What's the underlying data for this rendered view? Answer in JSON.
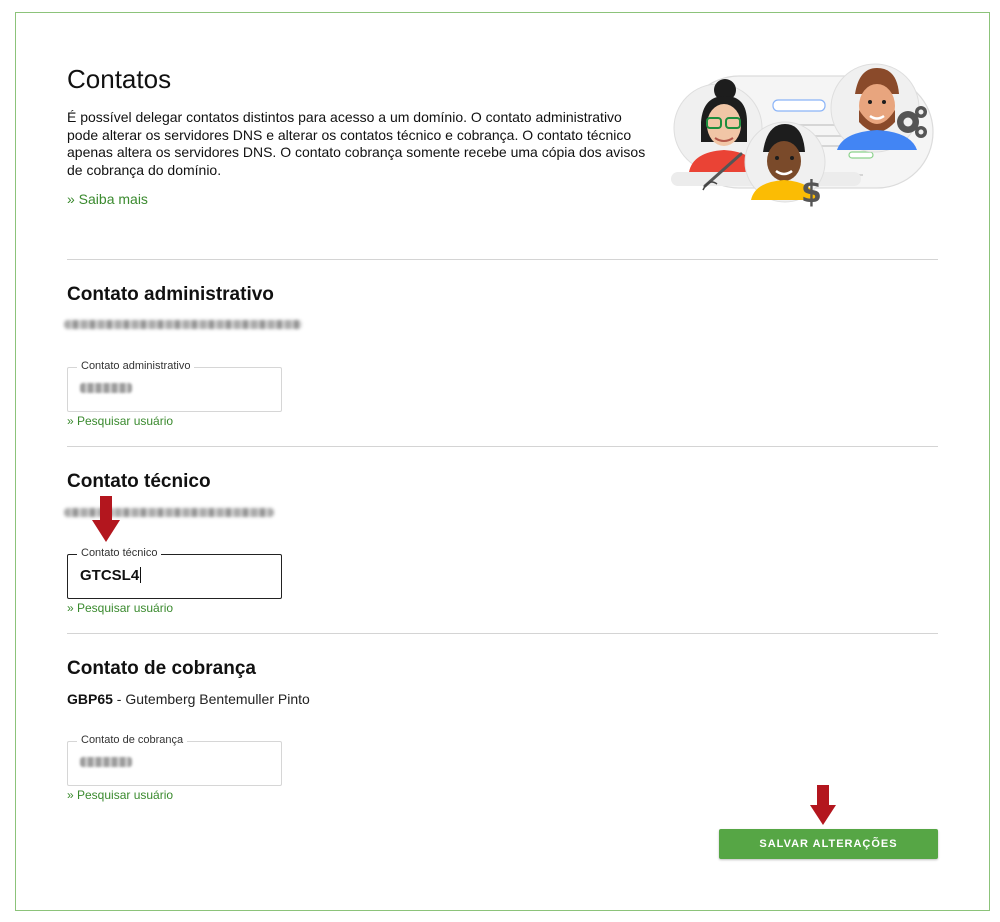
{
  "page": {
    "title": "Contatos",
    "description": "É possível delegar contatos distintos para acesso a um domínio. O contato administrativo pode alterar os servidores DNS e alterar os contatos técnico e cobrança. O contato técnico apenas altera os servidores DNS. O contato cobrança somente recebe uma cópia dos avisos de cobrança do domínio.",
    "learn_more": "» Saiba mais"
  },
  "admin": {
    "heading": "Contato administrativo",
    "field_label": "Contato administrativo",
    "search_link": "»  Pesquisar usuário"
  },
  "tech": {
    "heading": "Contato técnico",
    "field_label": "Contato técnico",
    "field_value": "GTCSL4",
    "search_link": "»  Pesquisar usuário"
  },
  "billing": {
    "heading": "Contato de cobrança",
    "contact_code": "GBP65",
    "contact_name": " - Gutemberg Bentemuller Pinto",
    "field_label": "Contato de cobrança",
    "search_link": "»  Pesquisar usuário"
  },
  "actions": {
    "save_label": "SALVAR ALTERAÇÕES"
  },
  "colors": {
    "accent_green": "#56a645",
    "link_green": "#3a8a2e",
    "frame_border": "#8cc37a",
    "annotation_arrow": "#b3161e"
  },
  "icons": {
    "illustration": "contacts-people-illustration",
    "arrow": "red-down-arrow-annotation"
  }
}
